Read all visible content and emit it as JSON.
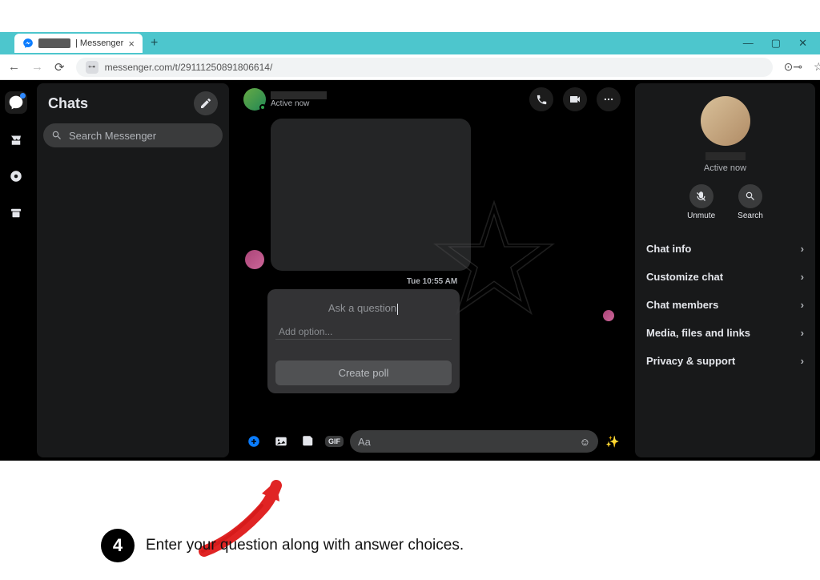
{
  "browser": {
    "tab_title": "| Messenger",
    "url": "messenger.com/t/29111250891806614/",
    "window_controls": {
      "min": "—",
      "max": "▢",
      "close": "✕"
    }
  },
  "rail": {
    "tooltip_chat": "Chats"
  },
  "sidebar": {
    "title": "Chats",
    "search_placeholder": "Search Messenger"
  },
  "conversation": {
    "status": "Active now",
    "timestamp": "Tue 10:55 AM",
    "composer_placeholder": "Aa",
    "gif_label": "GIF"
  },
  "poll": {
    "question_placeholder": "Ask a question",
    "option_placeholder": "Add option...",
    "button": "Create poll"
  },
  "info_panel": {
    "status": "Active now",
    "unmute": "Unmute",
    "search": "Search",
    "rows": [
      "Chat info",
      "Customize chat",
      "Chat members",
      "Media, files and links",
      "Privacy & support"
    ]
  },
  "annotation": {
    "step_number": "4",
    "text": "Enter your question along with answer choices."
  }
}
